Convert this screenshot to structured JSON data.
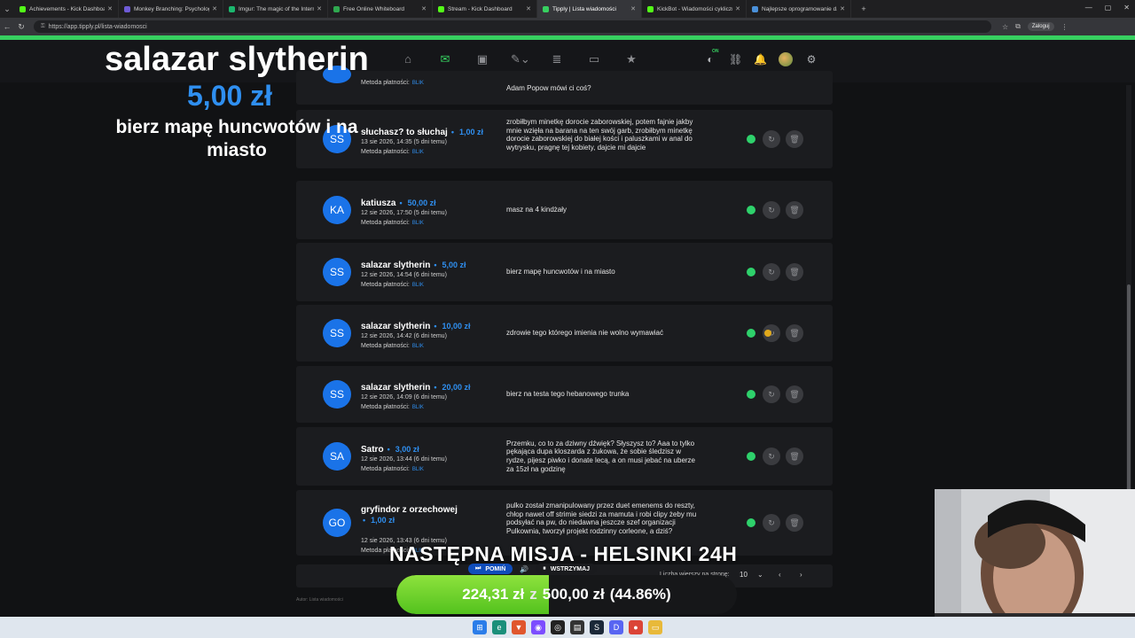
{
  "browser": {
    "tabs": [
      {
        "label": "Achievements - Kick Dashboard",
        "color": "#53fc18",
        "active": false
      },
      {
        "label": "Monkey Branching: Psychologia Z...",
        "color": "#6e5bd6",
        "active": false
      },
      {
        "label": "Imgur: The magic of the Internet",
        "color": "#1bb76e",
        "active": false
      },
      {
        "label": "Free Online Whiteboard",
        "color": "#2fa84f",
        "active": false
      },
      {
        "label": "Stream - Kick Dashboard",
        "color": "#53fc18",
        "active": false
      },
      {
        "label": "Tipply | Lista wiadomości",
        "color": "#37d060",
        "active": true
      },
      {
        "label": "KickBot - Wiadomości cykliczne",
        "color": "#53fc18",
        "active": false
      },
      {
        "label": "Najlepsze oprogramowanie d...",
        "color": "#4a90d9",
        "active": false
      }
    ],
    "url": "https://app.tipply.pl/lista-wiadomosci",
    "login_label": "Zaloguj"
  },
  "overlay": {
    "donor": "salazar slytherin",
    "amount": "5,00 zł",
    "message": "bierz mapę huncwotów i na miasto",
    "mission": "NASTĘPNA MISJA - HELSINKI 24H",
    "skip_label": "POMIŃ",
    "pause_label": "WSTRZYMAJ",
    "goal_current": "224,31 zł",
    "goal_sep": "z",
    "goal_target": "500,00 zł",
    "goal_percent": "(44.86%)",
    "goal_fraction": 0.4486
  },
  "list": {
    "partial_top": {
      "message": "Adam Popow mówi ci coś?",
      "payment_label": "Metoda płatności:",
      "payment": "BLIK"
    },
    "rows": [
      {
        "initials": "SS",
        "name": "słuchasz? to słuchaj",
        "amount": "1,00 zł",
        "date": "13 sie 2026, 14:35 (5 dni temu)",
        "payment_label": "Metoda płatności:",
        "payment": "BLIK",
        "message": "zrobiłbym minetkę dorocie zaborowskiej, potem fajnie jakby mnie wzięła na barana na ten swój garb, zrobiłbym minetkę dorocie zaborowskiej do białej kości i paluszkami w anal do wytrysku, pragnę tej kobiety, dajcie mi dajcie"
      },
      {
        "initials": "KA",
        "name": "katiusza",
        "amount": "50,00 zł",
        "date": "12 sie 2026, 17:50 (5 dni temu)",
        "payment_label": "Metoda płatności:",
        "payment": "BLIK",
        "message": "masz na 4 kindżały"
      },
      {
        "initials": "SS",
        "name": "salazar slytherin",
        "amount": "5,00 zł",
        "date": "12 sie 2026, 14:54 (6 dni temu)",
        "payment_label": "Metoda płatności:",
        "payment": "BLIK",
        "message": "bierz mapę huncwotów i na miasto"
      },
      {
        "initials": "SS",
        "name": "salazar slytherin",
        "amount": "10,00 zł",
        "date": "12 sie 2026, 14:42 (6 dni temu)",
        "payment_label": "Metoda płatności:",
        "payment": "BLIK",
        "message": "zdrowie tego którego imienia nie wolno wymawiać"
      },
      {
        "initials": "SS",
        "name": "salazar slytherin",
        "amount": "20,00 zł",
        "date": "12 sie 2026, 14:09 (6 dni temu)",
        "payment_label": "Metoda płatności:",
        "payment": "BLIK",
        "message": "bierz na testa tego hebanowego trunka"
      },
      {
        "initials": "SA",
        "name": "Satro",
        "amount": "3,00 zł",
        "date": "12 sie 2026, 13:44 (6 dni temu)",
        "payment_label": "Metoda płatności:",
        "payment": "BLIK",
        "message": "Przemku, co to za dziwny dźwięk? Słyszysz to? Aaa to tylko pękająca dupa kloszarda z żukowa, że sobie śledzisz w rydze, pijesz piwko i donate lecą, a on musi jebać na uberze za 15zł na godzinę"
      },
      {
        "initials": "GO",
        "name": "gryfindor z orzechowej",
        "amount": "1,00 zł",
        "date": "12 sie 2026, 13:43 (6 dni temu)",
        "payment_label": "Metoda płatności:",
        "payment": "BLIK",
        "message": "pulko został zmanipulowany przez duet emenems do reszty, chłop nawet off strimie siedzi za mamuta i robi clipy żeby mu podsyłać na pw, do niedawna jeszcze szef organizacji Pulkownia, tworzył projekt rodzinny corleone, a dziś?"
      }
    ],
    "pager_label": "Liczba wierszy na stronę:",
    "rows_per_page": "10"
  },
  "footer_note": "Autor: Lista wiadomości",
  "colors": {
    "accent": "#37d060",
    "amount_blue": "#2f8ff0",
    "avatar_blue": "#1a73e8",
    "status_green": "#2ed16b"
  }
}
